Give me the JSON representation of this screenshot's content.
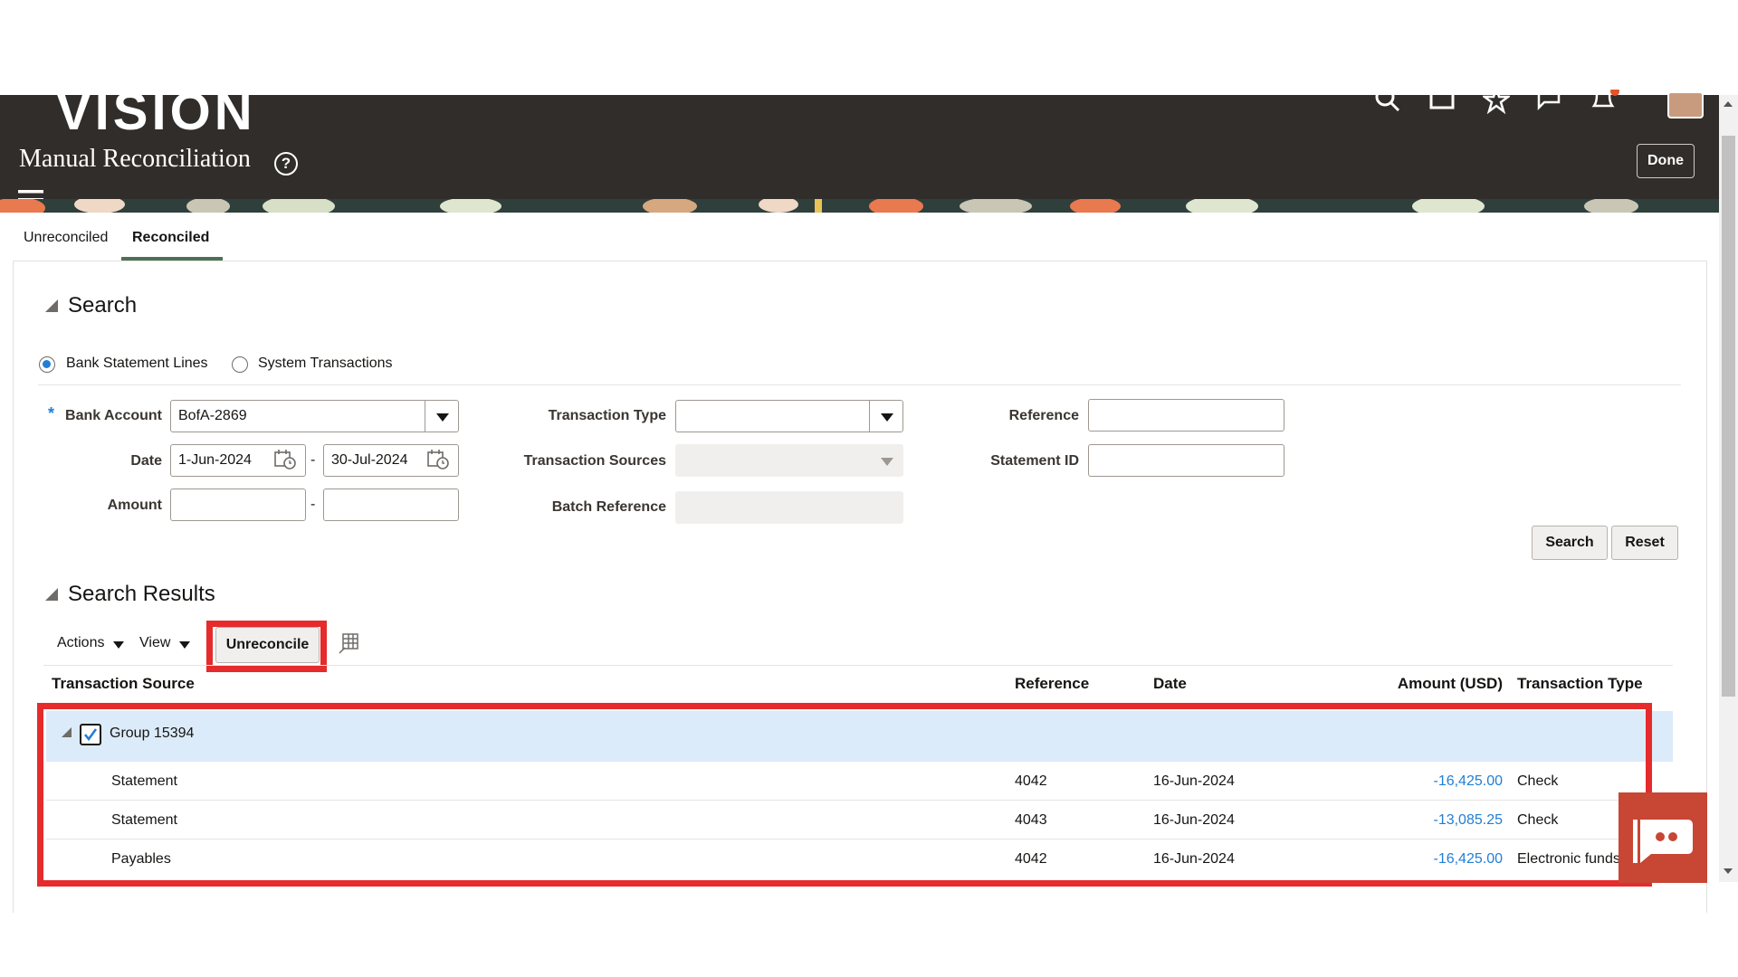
{
  "header": {
    "brand": "VISION",
    "title": "Manual Reconciliation",
    "help_glyph": "?",
    "done_label": "Done",
    "icons": [
      "menu-icon",
      "search-icon",
      "home-icon",
      "star-icon",
      "flag-icon",
      "bell-icon",
      "avatar"
    ]
  },
  "tabs": [
    {
      "label": "Unreconciled"
    },
    {
      "label": "Reconciled"
    }
  ],
  "search": {
    "title": "Search",
    "radio_bank": "Bank Statement Lines",
    "radio_system": "System Transactions",
    "required_mark": "*",
    "bank_account_label": "Bank Account",
    "bank_account_value": "BofA-2869",
    "date_label": "Date",
    "date_from": "1-Jun-2024",
    "date_to": "30-Jul-2024",
    "range_sep": "-",
    "amount_label": "Amount",
    "transaction_type_label": "Transaction Type",
    "transaction_sources_label": "Transaction Sources",
    "batch_reference_label": "Batch Reference",
    "reference_label": "Reference",
    "statement_id_label": "Statement ID",
    "search_button": "Search",
    "reset_button": "Reset"
  },
  "results": {
    "title": "Search Results",
    "actions_label": "Actions",
    "view_label": "View",
    "unreconcile_label": "Unreconcile",
    "columns": [
      "Transaction Source",
      "Reference",
      "Date",
      "Amount (USD)",
      "Transaction Type"
    ],
    "group_label": "Group 15394",
    "rows": [
      {
        "source": "Statement",
        "reference": "4042",
        "date": "16-Jun-2024",
        "amount": "-16,425.00",
        "type": "Check"
      },
      {
        "source": "Statement",
        "reference": "4043",
        "date": "16-Jun-2024",
        "amount": "-13,085.25",
        "type": "Check"
      },
      {
        "source": "Payables",
        "reference": "4042",
        "date": "16-Jun-2024",
        "amount": "-16,425.00",
        "type": "Electronic funds"
      }
    ]
  },
  "colors": {
    "header_bg": "#312d2a",
    "accent_blue": "#227ed5",
    "highlight_red": "#e52b2b",
    "selected_row": "#dcebf9"
  }
}
